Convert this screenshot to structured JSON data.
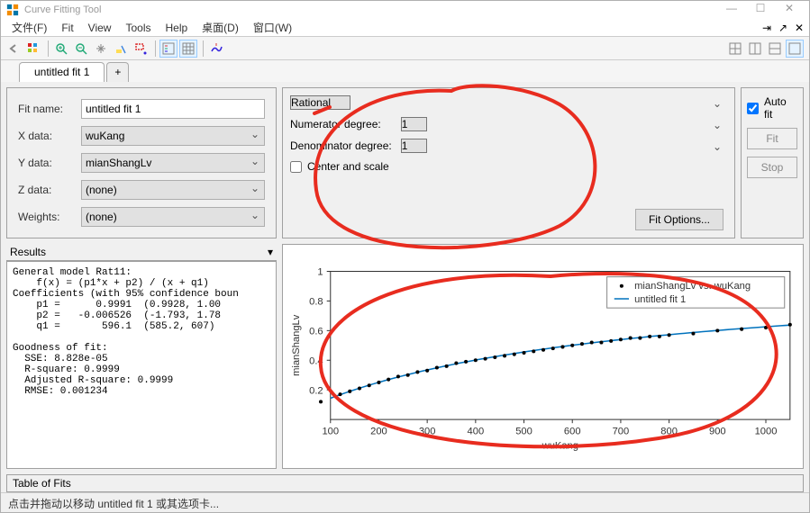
{
  "window": {
    "title": "Curve Fitting Tool",
    "min": "—",
    "max": "☐",
    "close": "✕"
  },
  "menu": {
    "file": "文件(F)",
    "fit": "Fit",
    "view": "View",
    "tools": "Tools",
    "help": "Help",
    "desktop": "桌面(D)",
    "window": "窗口(W)"
  },
  "tabs": {
    "active": "untitled fit 1",
    "add": "+"
  },
  "inputs": {
    "fitname_label": "Fit name:",
    "fitname_value": "untitled fit 1",
    "xdata_label": "X data:",
    "xdata_value": "wuKang",
    "ydata_label": "Y data:",
    "ydata_value": "mianShangLv",
    "zdata_label": "Z data:",
    "zdata_value": "(none)",
    "weights_label": "Weights:",
    "weights_value": "(none)"
  },
  "fit": {
    "type": "Rational",
    "num_label": "Numerator degree:",
    "num_val": "1",
    "den_label": "Denominator degree:",
    "den_val": "1",
    "center_label": "Center and scale",
    "options_label": "Fit Options..."
  },
  "right": {
    "auto": "Auto fit",
    "fit": "Fit",
    "stop": "Stop"
  },
  "results": {
    "title": "Results",
    "text": "General model Rat11:\n    f(x) = (p1*x + p2) / (x + q1)\nCoefficients (with 95% confidence boun\n    p1 =      0.9991  (0.9928, 1.00\n    p2 =   -0.006526  (-1.793, 1.78\n    q1 =       596.1  (585.2, 607)\n\nGoodness of fit:\n  SSE: 8.828e-05\n  R-square: 0.9999\n  Adjusted R-square: 0.9999\n  RMSE: 0.001234"
  },
  "chart": {
    "xlabel": "wuKang",
    "ylabel": "mianShangLv",
    "legend_data": "mianShangLv vs. wuKang",
    "legend_fit": "untitled fit 1"
  },
  "chart_data": {
    "type": "scatter+line",
    "xlabel": "wuKang",
    "ylabel": "mianShangLv",
    "xlim": [
      100,
      1050
    ],
    "ylim": [
      0,
      1
    ],
    "xticks": [
      100,
      200,
      300,
      400,
      500,
      600,
      700,
      800,
      900,
      1000
    ],
    "yticks": [
      0.2,
      0.4,
      0.6,
      0.8,
      1
    ],
    "series": [
      {
        "name": "mianShangLv vs. wuKang",
        "type": "scatter",
        "x": [
          80,
          120,
          140,
          160,
          180,
          200,
          220,
          240,
          260,
          280,
          300,
          320,
          340,
          360,
          380,
          400,
          420,
          440,
          460,
          480,
          500,
          520,
          540,
          560,
          580,
          600,
          620,
          640,
          660,
          680,
          700,
          720,
          740,
          760,
          780,
          800,
          850,
          900,
          950,
          1000,
          1050
        ],
        "y": [
          0.12,
          0.17,
          0.19,
          0.21,
          0.23,
          0.25,
          0.27,
          0.29,
          0.3,
          0.32,
          0.33,
          0.35,
          0.36,
          0.38,
          0.39,
          0.4,
          0.41,
          0.42,
          0.43,
          0.44,
          0.45,
          0.46,
          0.47,
          0.48,
          0.49,
          0.5,
          0.51,
          0.52,
          0.52,
          0.53,
          0.54,
          0.55,
          0.55,
          0.56,
          0.56,
          0.57,
          0.58,
          0.6,
          0.61,
          0.62,
          0.64
        ]
      },
      {
        "name": "untitled fit 1",
        "type": "line",
        "fit": "rat11",
        "p1": 0.9991,
        "p2": -0.006526,
        "q1": 596.1
      }
    ]
  },
  "tof": "Table of Fits",
  "status": "点击并拖动以移动 untitled fit 1 或其选项卡..."
}
